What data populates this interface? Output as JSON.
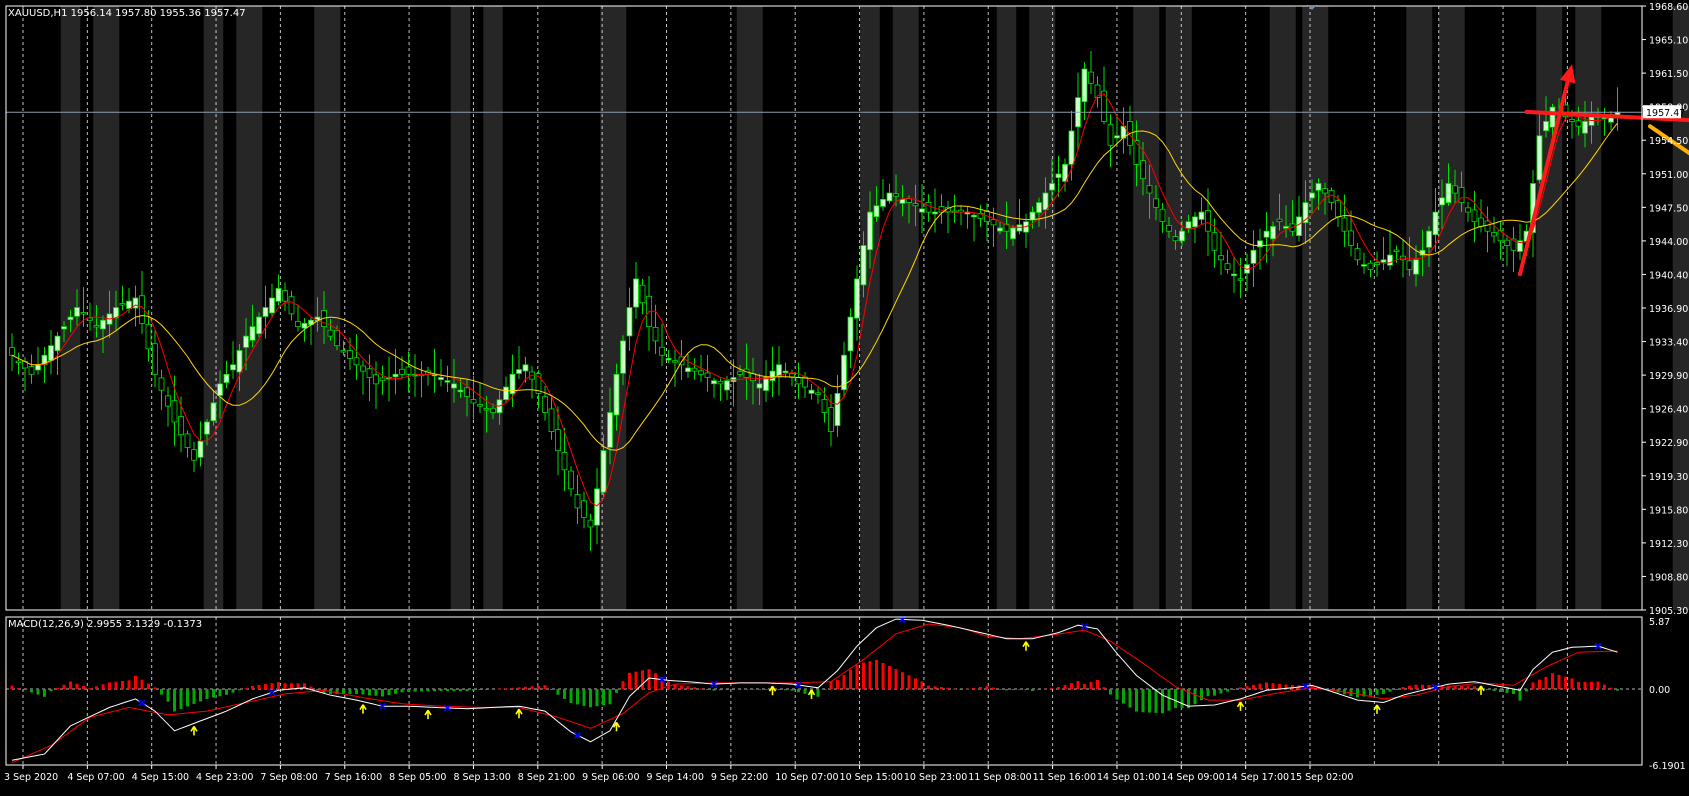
{
  "header": {
    "title": "XAUUSD,H1  1956.14 1957.80 1955.36 1957.47"
  },
  "macd_header": {
    "title": "MACD(12,26,9) 2.9955 3.1329 -0.1373"
  },
  "current_price_label": "1957.47",
  "colors": {
    "background": "#000000",
    "bull_candle": "#ccffcc",
    "bear_candle": "#000000",
    "wick": "#00dd00",
    "ma_fast": "#ff0000",
    "ma_slow": "#ffd700",
    "session_band": "#262626",
    "grid": "#ffffff",
    "price_line": "#8a9db0",
    "macd_hist_pos": "#ff0000",
    "macd_hist_neg": "#00aa00",
    "macd_line": "#ffffff",
    "signal_line": "#ff0000",
    "arrow_up": "#ffff00",
    "arrow_down": "#0000ff",
    "annot_red": "#ff1a1a",
    "annot_orange": "#ffb000"
  },
  "chart_data": [
    {
      "type": "candlestick",
      "symbol": "XAUUSD",
      "timeframe": "H1",
      "ohlc_now": {
        "open": 1956.14,
        "high": 1957.8,
        "low": 1955.36,
        "close": 1957.47
      },
      "ylim": [
        1905.3,
        1968.6
      ],
      "y_ticks": [
        "1968.60",
        "1965.10",
        "1961.50",
        "1958.00",
        "1954.50",
        "1951.00",
        "1947.50",
        "1944.00",
        "1940.40",
        "1936.90",
        "1933.40",
        "1929.90",
        "1926.40",
        "1922.90",
        "1919.30",
        "1915.80",
        "1912.30",
        "1908.80",
        "1905.30"
      ],
      "x_ticks": [
        "3 Sep 2020",
        "4 Sep 07:00",
        "4 Sep 15:00",
        "4 Sep 23:00",
        "7 Sep 08:00",
        "7 Sep 16:00",
        "8 Sep 05:00",
        "8 Sep 13:00",
        "8 Sep 21:00",
        "9 Sep 06:00",
        "9 Sep 14:00",
        "9 Sep 22:00",
        "10 Sep 07:00",
        "10 Sep 15:00",
        "10 Sep 23:00",
        "11 Sep 08:00",
        "11 Sep 16:00",
        "14 Sep 01:00",
        "14 Sep 09:00",
        "14 Sep 17:00",
        "15 Sep 02:00"
      ],
      "close_anchors": [
        [
          0,
          1932
        ],
        [
          3,
          1930
        ],
        [
          5,
          1932
        ],
        [
          8,
          1935
        ],
        [
          10,
          1937
        ],
        [
          13,
          1935
        ],
        [
          16,
          1937
        ],
        [
          19,
          1938
        ],
        [
          22,
          1930
        ],
        [
          25,
          1925
        ],
        [
          28,
          1921
        ],
        [
          30,
          1925
        ],
        [
          32,
          1929
        ],
        [
          34,
          1931
        ],
        [
          36,
          1934
        ],
        [
          38,
          1936
        ],
        [
          41,
          1939
        ],
        [
          44,
          1935
        ],
        [
          47,
          1936
        ],
        [
          50,
          1933
        ],
        [
          53,
          1931
        ],
        [
          56,
          1929
        ],
        [
          59,
          1930
        ],
        [
          62,
          1930
        ],
        [
          65,
          1930
        ],
        [
          68,
          1929
        ],
        [
          71,
          1927
        ],
        [
          74,
          1926
        ],
        [
          77,
          1930
        ],
        [
          79,
          1931
        ],
        [
          81,
          1928
        ],
        [
          83,
          1924
        ],
        [
          85,
          1920
        ],
        [
          87,
          1916
        ],
        [
          89,
          1914
        ],
        [
          91,
          1922
        ],
        [
          93,
          1930
        ],
        [
          95,
          1937
        ],
        [
          96,
          1940
        ],
        [
          98,
          1935
        ],
        [
          100,
          1932
        ],
        [
          103,
          1931
        ],
        [
          106,
          1930
        ],
        [
          109,
          1929
        ],
        [
          112,
          1930
        ],
        [
          115,
          1929
        ],
        [
          118,
          1931
        ],
        [
          121,
          1929
        ],
        [
          124,
          1928
        ],
        [
          126,
          1924
        ],
        [
          128,
          1932
        ],
        [
          130,
          1940
        ],
        [
          132,
          1947
        ],
        [
          135,
          1949
        ],
        [
          138,
          1948
        ],
        [
          141,
          1947
        ],
        [
          144,
          1947
        ],
        [
          147,
          1947
        ],
        [
          150,
          1946
        ],
        [
          153,
          1945
        ],
        [
          156,
          1946
        ],
        [
          159,
          1949
        ],
        [
          162,
          1952
        ],
        [
          164,
          1959
        ],
        [
          165,
          1962
        ],
        [
          167,
          1959
        ],
        [
          169,
          1954
        ],
        [
          171,
          1956
        ],
        [
          173,
          1952
        ],
        [
          175,
          1949
        ],
        [
          177,
          1946
        ],
        [
          179,
          1944
        ],
        [
          181,
          1946
        ],
        [
          183,
          1947
        ],
        [
          185,
          1943
        ],
        [
          187,
          1941
        ],
        [
          189,
          1940
        ],
        [
          191,
          1943
        ],
        [
          193,
          1945
        ],
        [
          195,
          1946
        ],
        [
          197,
          1945
        ],
        [
          199,
          1948
        ],
        [
          201,
          1950
        ],
        [
          203,
          1948
        ],
        [
          205,
          1945
        ],
        [
          207,
          1942
        ],
        [
          209,
          1941
        ],
        [
          211,
          1942
        ],
        [
          213,
          1943
        ],
        [
          215,
          1941
        ],
        [
          217,
          1943
        ],
        [
          219,
          1947
        ],
        [
          221,
          1950
        ],
        [
          223,
          1948
        ],
        [
          225,
          1946
        ],
        [
          227,
          1945
        ],
        [
          229,
          1944
        ],
        [
          231,
          1943
        ],
        [
          233,
          1945
        ],
        [
          235,
          1955
        ],
        [
          237,
          1958
        ],
        [
          239,
          1957
        ],
        [
          241,
          1956
        ],
        [
          243,
          1957
        ],
        [
          245,
          1957
        ],
        [
          247,
          1957.47
        ]
      ],
      "series": [
        {
          "name": "",
          "kind": "ma",
          "color": "#ff0000",
          "period": 5
        },
        {
          "name": "",
          "kind": "ma",
          "color": "#ffd700",
          "period": 14
        }
      ],
      "session_bands": [
        [
          8,
          11
        ],
        [
          13,
          17
        ],
        [
          30,
          33
        ],
        [
          35,
          39
        ],
        [
          47,
          51
        ],
        [
          68,
          71
        ],
        [
          73,
          76
        ],
        [
          91,
          95
        ],
        [
          112,
          116
        ],
        [
          131,
          134
        ],
        [
          136,
          140
        ],
        [
          152,
          155
        ],
        [
          157,
          161
        ],
        [
          173,
          177
        ],
        [
          178,
          182
        ],
        [
          194,
          198
        ],
        [
          199,
          203
        ],
        [
          215,
          219
        ],
        [
          220,
          224
        ],
        [
          235,
          239
        ],
        [
          241,
          245
        ],
        [
          256,
          259
        ],
        [
          262,
          266
        ]
      ],
      "grid": true,
      "annotations": [
        {
          "kind": "arrow",
          "color": "red",
          "from": [
            232,
            1940.5
          ],
          "to": [
            240,
            1962.5
          ]
        },
        {
          "kind": "arrow",
          "color": "red",
          "from": [
            233,
            1957.5
          ],
          "to": [
            262,
            1956.5
          ]
        },
        {
          "kind": "arrow",
          "color": "red",
          "from": [
            262,
            1957
          ],
          "to": [
            268,
            1964.5
          ]
        },
        {
          "kind": "arrow",
          "color": "orange",
          "from": [
            252,
            1956
          ],
          "to": [
            267,
            1949
          ]
        },
        {
          "kind": "arrow",
          "color": "orange",
          "from": [
            267,
            1949
          ],
          "to": [
            278,
            1962.5
          ]
        }
      ]
    },
    {
      "type": "histogram+line",
      "name": "MACD",
      "params": [
        12,
        26,
        9
      ],
      "values_now": {
        "macd": 2.9955,
        "signal": 3.1329,
        "histogram": -0.1373
      },
      "ylim": [
        -6.1901,
        5.87
      ],
      "y_ticks": [
        "5.87",
        "0.00",
        "-6.1901"
      ],
      "macd_anchors": [
        [
          0,
          -5.8
        ],
        [
          5,
          -5.3
        ],
        [
          9,
          -3.0
        ],
        [
          15,
          -1.5
        ],
        [
          19,
          -0.8
        ],
        [
          22,
          -1.8
        ],
        [
          25,
          -3.4
        ],
        [
          29,
          -2.6
        ],
        [
          33,
          -1.8
        ],
        [
          37,
          -0.8
        ],
        [
          41,
          -0.1
        ],
        [
          45,
          0.1
        ],
        [
          49,
          -0.5
        ],
        [
          53,
          -0.9
        ],
        [
          57,
          -1.4
        ],
        [
          61,
          -1.4
        ],
        [
          65,
          -1.5
        ],
        [
          70,
          -1.6
        ],
        [
          74,
          -1.5
        ],
        [
          78,
          -1.4
        ],
        [
          82,
          -1.8
        ],
        [
          86,
          -3.5
        ],
        [
          89,
          -4.3
        ],
        [
          92,
          -3.4
        ],
        [
          95,
          -0.6
        ],
        [
          98,
          0.9
        ],
        [
          101,
          0.7
        ],
        [
          104,
          0.6
        ],
        [
          108,
          0.4
        ],
        [
          112,
          0.5
        ],
        [
          116,
          0.5
        ],
        [
          120,
          0.4
        ],
        [
          124,
          0.1
        ],
        [
          127,
          1.5
        ],
        [
          130,
          3.5
        ],
        [
          133,
          5.0
        ],
        [
          136,
          5.7
        ],
        [
          140,
          5.6
        ],
        [
          144,
          5.2
        ],
        [
          149,
          4.6
        ],
        [
          153,
          4.1
        ],
        [
          157,
          4.1
        ],
        [
          161,
          4.6
        ],
        [
          164,
          5.2
        ],
        [
          167,
          4.9
        ],
        [
          170,
          2.9
        ],
        [
          173,
          1.1
        ],
        [
          177,
          -0.5
        ],
        [
          181,
          -1.4
        ],
        [
          185,
          -1.3
        ],
        [
          189,
          -0.8
        ],
        [
          193,
          -0.1
        ],
        [
          197,
          0.1
        ],
        [
          200,
          0.3
        ],
        [
          203,
          -0.2
        ],
        [
          207,
          -0.9
        ],
        [
          211,
          -1.1
        ],
        [
          214,
          -0.5
        ],
        [
          217,
          -0.1
        ],
        [
          221,
          0.4
        ],
        [
          225,
          0.6
        ],
        [
          229,
          0.2
        ],
        [
          232,
          -0.1
        ],
        [
          234,
          1.6
        ],
        [
          237,
          3.0
        ],
        [
          240,
          3.4
        ],
        [
          244,
          3.5
        ],
        [
          247,
          3.0
        ]
      ],
      "signal_anchors": [
        [
          0,
          -6.0
        ],
        [
          6,
          -4.6
        ],
        [
          12,
          -2.3
        ],
        [
          18,
          -1.5
        ],
        [
          24,
          -2.1
        ],
        [
          30,
          -1.8
        ],
        [
          36,
          -1.1
        ],
        [
          42,
          -0.4
        ],
        [
          48,
          -0.1
        ],
        [
          54,
          -0.7
        ],
        [
          60,
          -1.2
        ],
        [
          66,
          -1.4
        ],
        [
          72,
          -1.5
        ],
        [
          78,
          -1.5
        ],
        [
          84,
          -2.3
        ],
        [
          89,
          -3.2
        ],
        [
          94,
          -2.0
        ],
        [
          98,
          -0.3
        ],
        [
          102,
          0.4
        ],
        [
          108,
          0.5
        ],
        [
          114,
          0.5
        ],
        [
          120,
          0.5
        ],
        [
          126,
          0.6
        ],
        [
          131,
          2.4
        ],
        [
          136,
          4.5
        ],
        [
          141,
          5.3
        ],
        [
          146,
          5.0
        ],
        [
          150,
          4.3
        ],
        [
          155,
          4.1
        ],
        [
          160,
          4.4
        ],
        [
          165,
          4.8
        ],
        [
          169,
          3.9
        ],
        [
          174,
          2.1
        ],
        [
          179,
          0.2
        ],
        [
          184,
          -0.9
        ],
        [
          189,
          -0.9
        ],
        [
          195,
          -0.3
        ],
        [
          200,
          0.1
        ],
        [
          206,
          -0.3
        ],
        [
          211,
          -0.8
        ],
        [
          216,
          -0.5
        ],
        [
          221,
          0.2
        ],
        [
          226,
          0.5
        ],
        [
          231,
          0.3
        ],
        [
          236,
          1.8
        ],
        [
          241,
          3.0
        ],
        [
          247,
          3.1
        ]
      ],
      "up_markers": [
        28,
        54,
        64,
        78,
        93,
        117,
        123,
        156,
        189,
        210,
        226
      ],
      "down_markers": [
        20,
        40,
        57,
        67,
        87,
        100,
        108,
        121,
        137,
        165,
        199,
        219,
        244
      ]
    }
  ]
}
